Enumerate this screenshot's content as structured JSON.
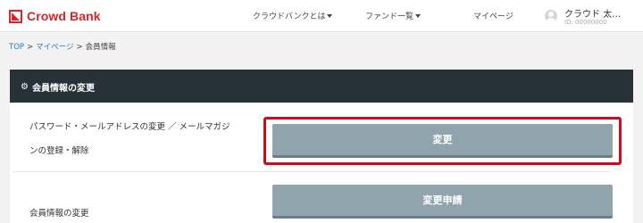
{
  "header": {
    "logo_text": "Crowd Bank",
    "nav": [
      {
        "label": "クラウドバンクとは"
      },
      {
        "label": "ファンド一覧"
      },
      {
        "label": "マイページ"
      }
    ],
    "user": {
      "name": "クラウド 太…",
      "id": "ID: 00000000"
    }
  },
  "breadcrumb": {
    "items": [
      "TOP",
      "マイページ",
      "会員情報"
    ],
    "separator": ">"
  },
  "panel": {
    "title": "会員情報の変更",
    "rows": [
      {
        "label_line1": "パスワード・メールアドレスの変更 ／ メールマガジ",
        "label_line2": "ンの登録・解除",
        "button": "変更"
      },
      {
        "label": "会員情報の変更",
        "button": "変更申請"
      }
    ]
  },
  "colors": {
    "brand": "#d8232a",
    "panel_header": "#263238",
    "button": "#90a4ae",
    "highlight": "#cc0d18",
    "link": "#2a7ac2"
  }
}
